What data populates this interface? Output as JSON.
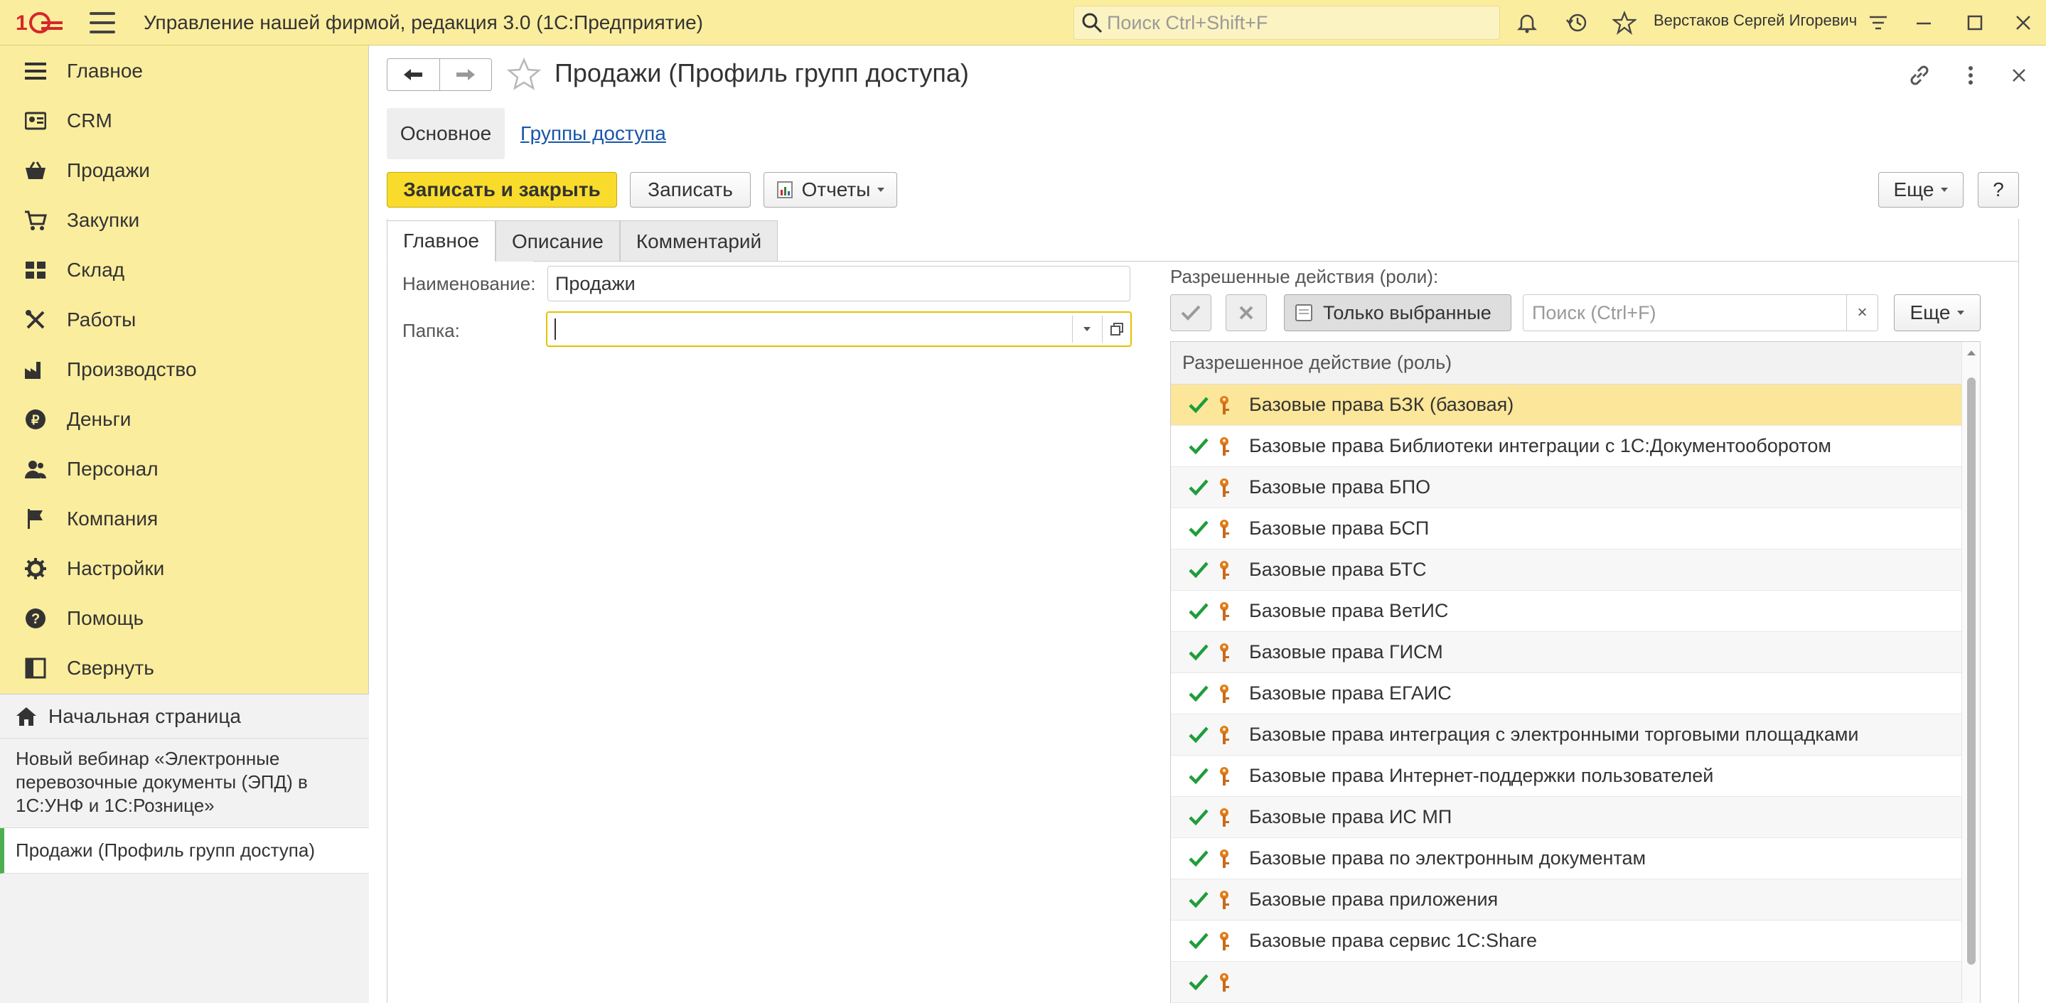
{
  "app": {
    "title": "Управление нашей фирмой, редакция 3.0  (1С:Предприятие)",
    "search_placeholder": "Поиск Ctrl+Shift+F",
    "user": "Верстаков Сергей Игоревич",
    "accent": "#fbed9e"
  },
  "sidebar": {
    "items": [
      {
        "label": "Главное",
        "icon": "list-icon"
      },
      {
        "label": "CRM",
        "icon": "contacts-icon"
      },
      {
        "label": "Продажи",
        "icon": "basket-icon"
      },
      {
        "label": "Закупки",
        "icon": "cart-icon"
      },
      {
        "label": "Склад",
        "icon": "warehouse-icon"
      },
      {
        "label": "Работы",
        "icon": "tools-icon"
      },
      {
        "label": "Производство",
        "icon": "factory-icon"
      },
      {
        "label": "Деньги",
        "icon": "ruble-icon"
      },
      {
        "label": "Персонал",
        "icon": "people-icon"
      },
      {
        "label": "Компания",
        "icon": "flag-icon"
      },
      {
        "label": "Настройки",
        "icon": "gear-icon"
      },
      {
        "label": "Помощь",
        "icon": "help-icon"
      },
      {
        "label": "Свернуть",
        "icon": "collapse-icon"
      }
    ],
    "home_label": "Начальная страница",
    "webinar_text": "Новый вебинар «Электронные перевозочные документы (ЭПД) в 1С:УНФ и 1С:Рознице»",
    "open_tab_label": "Продажи (Профиль групп доступа)"
  },
  "form": {
    "title": "Продажи (Профиль групп доступа)",
    "tab_main": "Основное",
    "tab_link": "Группы доступа",
    "toolbar": {
      "save_close": "Записать и закрыть",
      "save": "Записать",
      "reports": "Отчеты",
      "more": "Еще",
      "help": "?"
    },
    "subtabs": [
      "Главное",
      "Описание",
      "Комментарий"
    ],
    "name_label": "Наименование:",
    "name_value": "Продажи",
    "folder_label": "Папка:",
    "folder_value": ""
  },
  "roles": {
    "title": "Разрешенные действия (роли):",
    "only_selected": "Только выбранные",
    "search_placeholder": "Поиск (Ctrl+F)",
    "more": "Еще",
    "column_header": "Разрешенное действие (роль)",
    "rows": [
      {
        "label": "Базовые права БЗК (базовая)",
        "checked": true,
        "selected": true
      },
      {
        "label": "Базовые права Библиотеки интеграции с 1С:Документооборотом",
        "checked": true
      },
      {
        "label": "Базовые права БПО",
        "checked": true
      },
      {
        "label": "Базовые права БСП",
        "checked": true
      },
      {
        "label": "Базовые права БТС",
        "checked": true
      },
      {
        "label": "Базовые права ВетИС",
        "checked": true
      },
      {
        "label": "Базовые права ГИСМ",
        "checked": true
      },
      {
        "label": "Базовые права ЕГАИС",
        "checked": true
      },
      {
        "label": "Базовые права интеграция с электронными торговыми площадками",
        "checked": true
      },
      {
        "label": "Базовые права Интернет-поддержки пользователей",
        "checked": true
      },
      {
        "label": "Базовые права ИС МП",
        "checked": true
      },
      {
        "label": "Базовые права по электронным документам",
        "checked": true
      },
      {
        "label": "Базовые права приложения",
        "checked": true
      },
      {
        "label": "Базовые права сервис 1С:Share",
        "checked": true
      },
      {
        "label": "",
        "checked": true
      }
    ]
  }
}
